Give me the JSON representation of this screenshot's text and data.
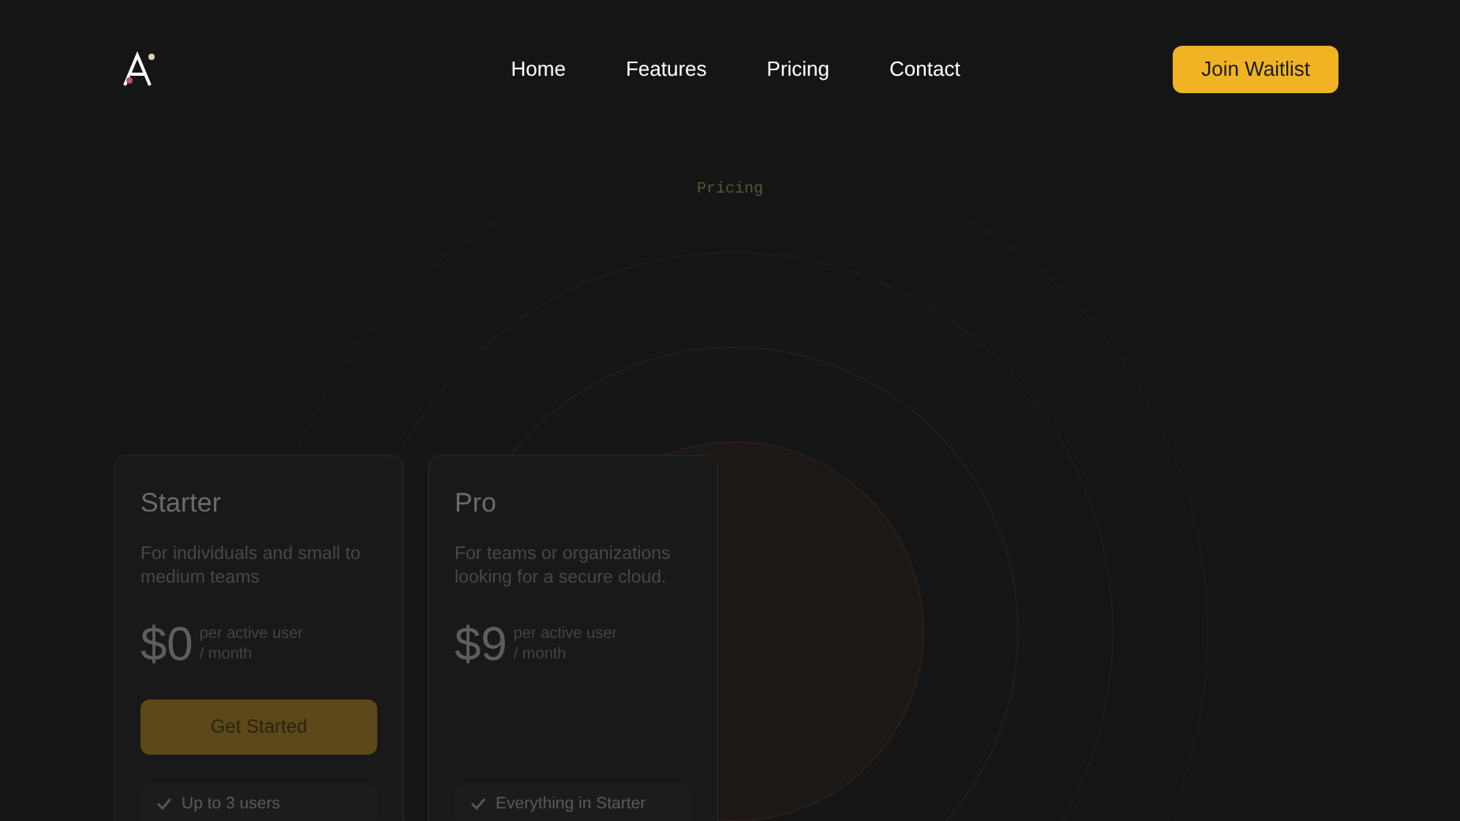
{
  "nav": {
    "links": [
      {
        "label": "Home"
      },
      {
        "label": "Features"
      },
      {
        "label": "Pricing"
      },
      {
        "label": "Contact"
      }
    ],
    "cta": "Join Waitlist"
  },
  "section": {
    "eyebrow": "Pricing"
  },
  "plans": [
    {
      "name": "Starter",
      "description": "For individuals and small to medium teams",
      "price": "$0",
      "unit_line_1": "per active user",
      "unit_line_2": "/ month",
      "button": "Get Started",
      "features": [
        "Up to 3 users"
      ]
    },
    {
      "name": "Pro",
      "description": "For teams or organizations looking for a secure cloud.",
      "price": "$9",
      "unit_line_1": "per active user",
      "unit_line_2": "/ month",
      "features": [
        "Everything in Starter"
      ]
    }
  ]
}
